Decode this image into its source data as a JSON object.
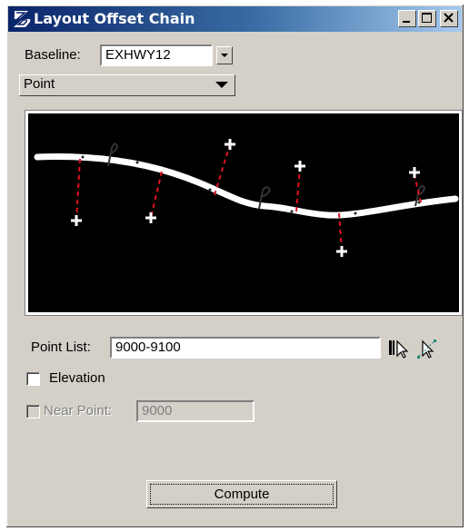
{
  "window": {
    "title": "Layout Offset Chain"
  },
  "baseline": {
    "label": "Baseline:",
    "value": "EXHWY12"
  },
  "mode": {
    "selected": "Point"
  },
  "point_list": {
    "label": "Point List:",
    "value": "9000-9100"
  },
  "elevation": {
    "label": "Elevation",
    "checked": false
  },
  "near_point": {
    "label": "Near Point:",
    "value": "9000",
    "checked": false,
    "enabled": false
  },
  "compute_button": {
    "label": "Compute"
  },
  "colors": {
    "title_start": "#0a246a",
    "title_end": "#a6caf0",
    "offset_line": "#e01020",
    "chain": "#ffffff",
    "preview_bg": "#000000"
  },
  "icons": [
    "bentley-app-icon",
    "minimize-icon",
    "maximize-icon",
    "close-icon",
    "select-element-icon",
    "select-points-icon"
  ]
}
